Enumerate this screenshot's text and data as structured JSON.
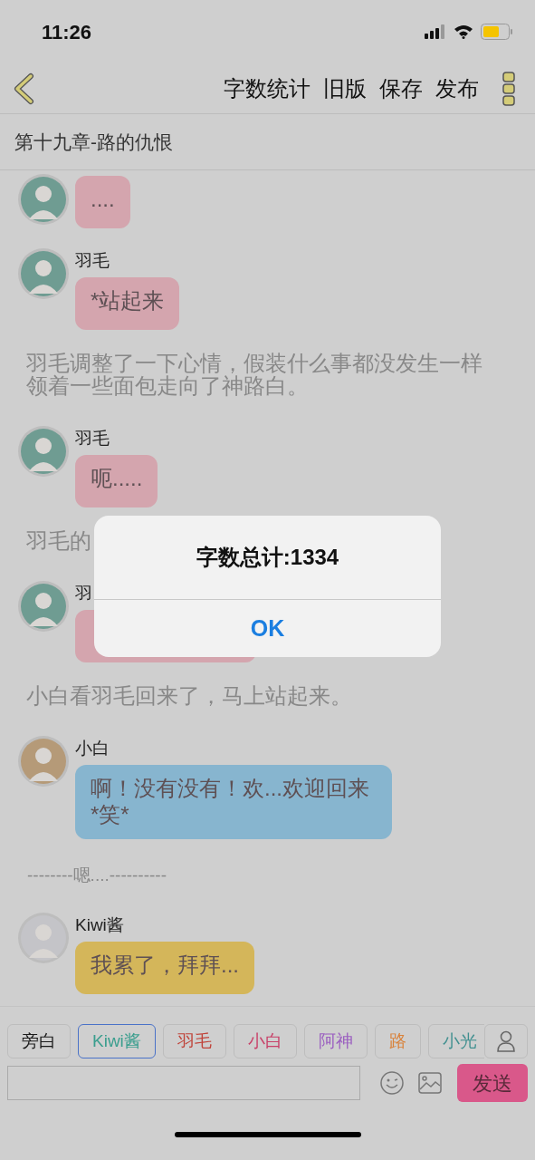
{
  "status_bar": {
    "time": "11:26"
  },
  "nav": {
    "actions": [
      "字数统计",
      "旧版",
      "保存",
      "发布"
    ]
  },
  "chapter_title": "第十九章-路的仇恨",
  "feed": [
    {
      "kind": "message",
      "avatar": {
        "color": "#6f9c92"
      },
      "color": "#d4a5ae",
      "text": "...."
    },
    {
      "kind": "message",
      "avatar": {
        "color": "#6f9c92"
      },
      "name": "羽毛",
      "color": "#d4a5ae",
      "text": "*站起来"
    },
    {
      "kind": "narration",
      "text": "羽毛调整了一下心情，假装什么事都没发生一样领着一些面包走向了神路白。"
    },
    {
      "kind": "message",
      "avatar": {
        "color": "#6f9c92"
      },
      "name": "羽毛",
      "color": "#d4a5ae",
      "text": "呃....."
    },
    {
      "kind": "narration",
      "text": "羽毛的"
    },
    {
      "kind": "message",
      "avatar": {
        "color": "#6f9c92"
      },
      "name": "羽",
      "color": "#d4a5ae"
    },
    {
      "kind": "narration",
      "text": "小白看羽毛回来了，马上站起来。"
    },
    {
      "kind": "message",
      "avatar": {
        "color": "#b59a78"
      },
      "name": "小白",
      "color": "#87b5cf",
      "text": "啊！没有没有！欢...欢迎回来*笑*"
    },
    {
      "kind": "divider",
      "text": "--------嗯....----------"
    },
    {
      "kind": "message",
      "avatar": {
        "color": "#c4c4c8"
      },
      "name": "Kiwi酱",
      "color": "#d4b65a",
      "text": "我累了，拜拜..."
    }
  ],
  "characters": [
    {
      "label": "旁白",
      "color": "#1a1a1a",
      "selected": false
    },
    {
      "label": "Kiwi酱",
      "color": "#3a9e8e",
      "selected": true
    },
    {
      "label": "羽毛",
      "color": "#c0443a",
      "selected": false
    },
    {
      "label": "小白",
      "color": "#c84068",
      "selected": false
    },
    {
      "label": "阿神",
      "color": "#9b5fc0",
      "selected": false
    },
    {
      "label": "路",
      "color": "#d9823a",
      "selected": false
    },
    {
      "label": "小光",
      "color": "#3f8f8f",
      "selected": false
    }
  ],
  "composer": {
    "send": "发送"
  },
  "dialog": {
    "title": "字数总计:1334",
    "button": "OK"
  }
}
